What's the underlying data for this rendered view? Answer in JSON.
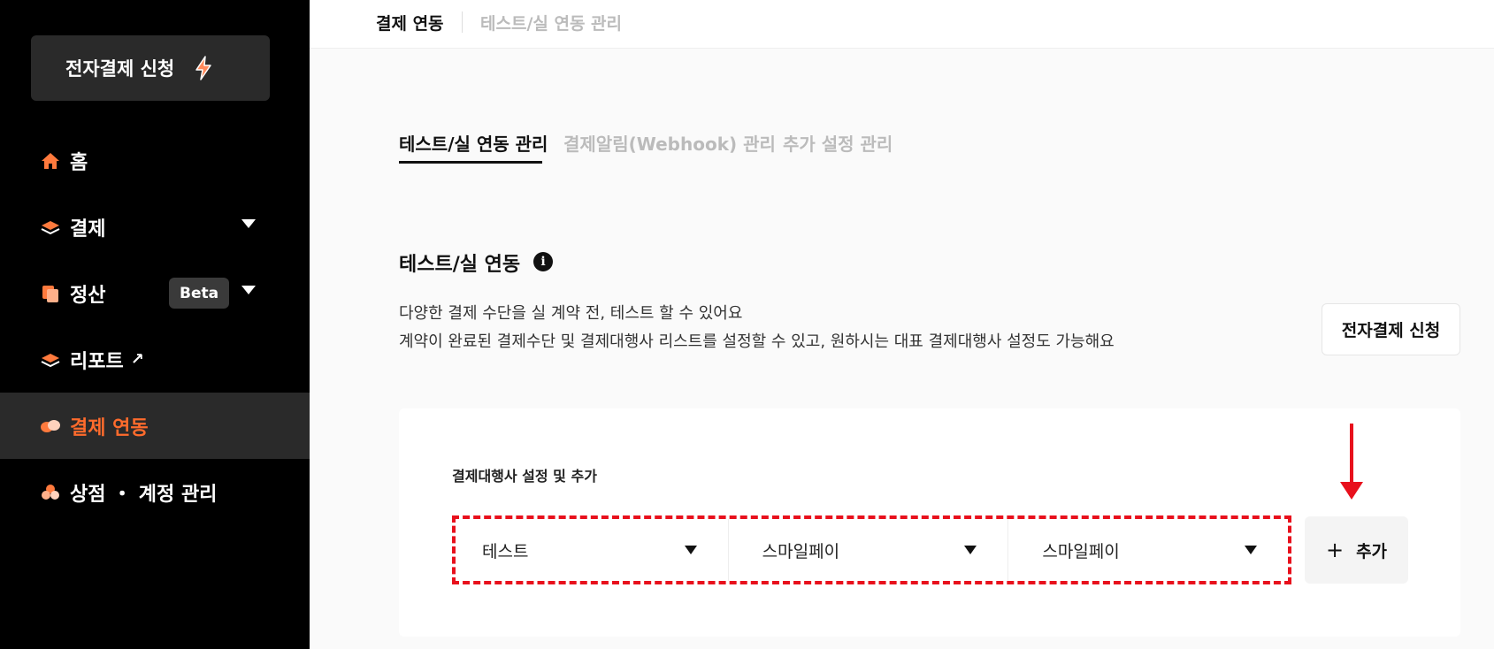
{
  "sidebar": {
    "apply_button": "전자결제 신청",
    "items": [
      {
        "label": "홈",
        "icon": "home-icon"
      },
      {
        "label": "결제",
        "icon": "layers-icon"
      },
      {
        "label": "정산",
        "icon": "copy-icon",
        "badge": "Beta"
      },
      {
        "label": "리포트",
        "icon": "layers-icon",
        "external": "↗"
      },
      {
        "label": "결제 연동",
        "icon": "link-icon"
      },
      {
        "label": "상점 ・ 계정 관리",
        "icon": "store-icon"
      }
    ]
  },
  "topbar": {
    "breadcrumb_1": "결제 연동",
    "breadcrumb_2": "테스트/실 연동 관리"
  },
  "tabs": [
    {
      "label": "테스트/실 연동 관리",
      "active": true
    },
    {
      "label": "결제알림(Webhook) 관리",
      "active": false
    },
    {
      "label": "추가 설정 관리",
      "active": false
    }
  ],
  "section": {
    "title": "테스트/실 연동",
    "desc_1": "다양한 결제 수단을 실 계약 전, 테스트 할 수 있어요",
    "desc_2": "계약이 완료된 결제수단 및 결제대행사 리스트를 설정할 수 있고, 원하시는 대표 결제대행사 설정도 가능해요",
    "apply_button": "전자결제 신청"
  },
  "card": {
    "title": "결제대행사 설정 및 추가",
    "selects": [
      "테스트",
      "스마일페이",
      "스마일페이"
    ],
    "add_button": "추가",
    "add_icon": "+"
  },
  "colors": {
    "accent": "#ff6b2c",
    "annotation_red": "#e8101c",
    "sidebar_bg": "#000000"
  }
}
